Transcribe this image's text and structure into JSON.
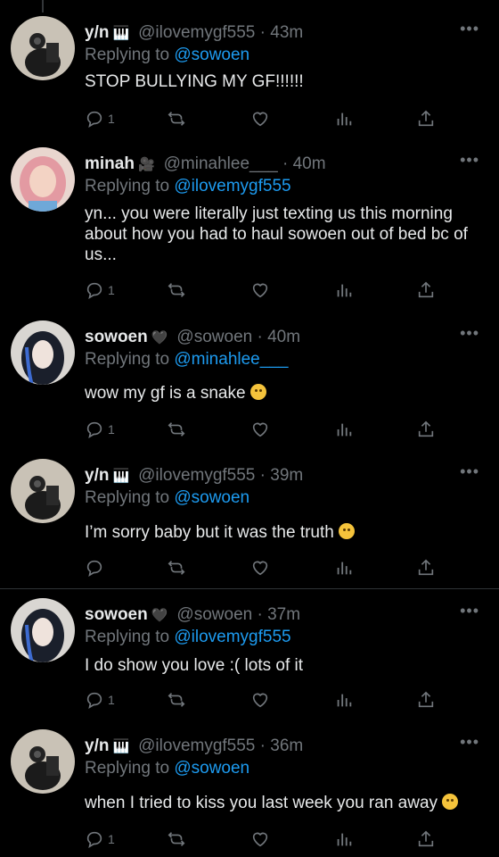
{
  "tweets": [
    {
      "name": "y/n",
      "badge": "🎹",
      "handle_time": "@ilovemygf555 · 43m",
      "replying_label": "Replying to",
      "replying_to": "@sowoen",
      "text": "STOP BULLYING MY GF!!!!!!",
      "reply_count": "1",
      "avatar": "cat-avatar"
    },
    {
      "name": "minah",
      "badge": "🎥",
      "handle_time": "@minahlee___ · 40m",
      "replying_label": "Replying to",
      "replying_to": "@ilovemygf555",
      "text": "yn... you were literally just texting us this morning about how you had to haul sowoen out of bed bc of us...",
      "reply_count": "1",
      "avatar": "pink-hair-avatar"
    },
    {
      "name": "sowoen",
      "badge": "🖤",
      "handle_time": "@sowoen · 40m",
      "replying_label": "Replying to",
      "replying_to": "@minahlee___",
      "text": "wow my gf is a snake",
      "reply_count": "1",
      "avatar": "blue-hair-avatar"
    },
    {
      "name": "y/n",
      "badge": "🎹",
      "handle_time": "@ilovemygf555 · 39m",
      "replying_label": "Replying to",
      "replying_to": "@sowoen",
      "text": "I’m sorry baby but it was the truth",
      "reply_count": "",
      "avatar": "cat-avatar"
    },
    {
      "name": "sowoen",
      "badge": "🖤",
      "handle_time": "@sowoen · 37m",
      "replying_label": "Replying to",
      "replying_to": "@ilovemygf555",
      "text": "I do show you love :( lots of it",
      "reply_count": "1",
      "avatar": "blue-hair-avatar"
    },
    {
      "name": "y/n",
      "badge": "🎹",
      "handle_time": "@ilovemygf555 · 36m",
      "replying_label": "Replying to",
      "replying_to": "@sowoen",
      "text": "when I tried to kiss you last week you ran away",
      "reply_count": "1",
      "avatar": "cat-avatar"
    }
  ],
  "more_label": "•••",
  "colors": {
    "background": "#000000",
    "text": "#e7e9ea",
    "muted": "#71767b",
    "link": "#1d9bf0"
  }
}
